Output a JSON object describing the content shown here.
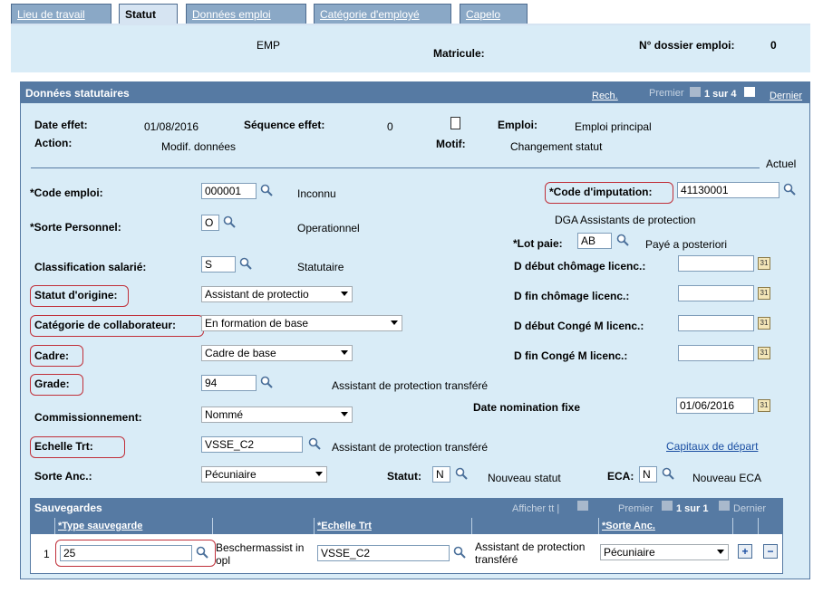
{
  "tabs": [
    {
      "label": "Lieu de travail"
    },
    {
      "label": "Statut"
    },
    {
      "label": "Données emploi"
    },
    {
      "label": "Catégorie d'employé"
    },
    {
      "label": "Capelo"
    }
  ],
  "header": {
    "emp": "EMP",
    "matricule_label": "Matricule:",
    "dossier_label": "N° dossier emploi:",
    "dossier_value": "0"
  },
  "section": {
    "title": "Données statutaires",
    "search_link": "Rech.",
    "first": "Premier",
    "range": "1 sur 4",
    "last": "Dernier"
  },
  "top": {
    "date_effet_label": "Date effet:",
    "date_effet_value": "01/08/2016",
    "sequence_label": "Séquence effet:",
    "sequence_value": "0",
    "emploi_label": "Emploi:",
    "emploi_value": "Emploi principal",
    "action_label": "Action:",
    "action_value": "Modif. données",
    "motif_label": "Motif:",
    "motif_value": "Changement statut",
    "actuel": "Actuel"
  },
  "fields": {
    "code_emploi_label": "*Code emploi:",
    "code_emploi_value": "000001",
    "code_emploi_desc": "Inconnu",
    "sorte_personnel_label": "*Sorte Personnel:",
    "sorte_personnel_value": "O",
    "sorte_personnel_desc": "Operationnel",
    "classification_label": "Classification salarié:",
    "classification_value": "S",
    "classification_desc": "Statutaire",
    "statut_origine_label": "Statut d'origine:",
    "statut_origine_value": "Assistant de protectio",
    "categorie_label": "Catégorie de collaborateur:",
    "categorie_value": "En formation de base",
    "cadre_label": "Cadre:",
    "cadre_value": "Cadre de base",
    "grade_label": "Grade:",
    "grade_value": "94",
    "grade_desc": "Assistant de protection transféré",
    "commission_label": "Commissionnement:",
    "commission_value": "Nommé",
    "echelle_label": "Echelle Trt:",
    "echelle_value": "VSSE_C2",
    "echelle_desc": "Assistant de protection transféré",
    "sorte_anc_label": "Sorte Anc.:",
    "sorte_anc_value": "Pécuniaire",
    "code_imputation_label": "*Code d'imputation:",
    "code_imputation_value": "41130001",
    "imputation_desc": "DGA Assistants de protection",
    "lot_paie_label": "*Lot paie:",
    "lot_paie_value": "AB",
    "lot_paie_desc": "Payé a posteriori",
    "debut_chomage_label": "D début chômage licenc.:",
    "fin_chomage_label": "D fin chômage licenc.:",
    "debut_conge_label": "D début Congé M licenc.:",
    "fin_conge_label": "D fin Congé M licenc.:",
    "date_nomination_label": "Date nomination fixe",
    "date_nomination_value": "01/06/2016",
    "capitaux_link": "Capitaux de départ",
    "statut_label": "Statut:",
    "statut_value": "N",
    "statut_desc": "Nouveau statut",
    "eca_label": "ECA:",
    "eca_value": "N",
    "eca_desc": "Nouveau ECA"
  },
  "grid": {
    "title": "Sauvegardes",
    "afficher": "Afficher tt |",
    "first": "Premier",
    "range": "1 sur 1",
    "last": "Dernier",
    "col_type": "*Type sauvegarde",
    "col_echelle": "*Echelle Trt",
    "col_sorte": "*Sorte Anc.",
    "row_num": "1",
    "row_type": "25",
    "row_type_desc": "Beschermassist in opl",
    "row_echelle": "VSSE_C2",
    "row_echelle_desc": "Assistant de protection transféré",
    "row_sorte": "Pécuniaire",
    "add": "+",
    "remove": "−"
  },
  "colors": {
    "section_header": "#567aa3",
    "tab_inactive": "#8aa8c6",
    "light_band": "#d9ecf7",
    "annotation_red": "#c0303a"
  },
  "icons": [
    "search-icon",
    "calendar-icon",
    "notepad-icon",
    "nav-first-icon",
    "nav-last-icon",
    "view-all-icon",
    "add-row-icon",
    "delete-row-icon"
  ]
}
